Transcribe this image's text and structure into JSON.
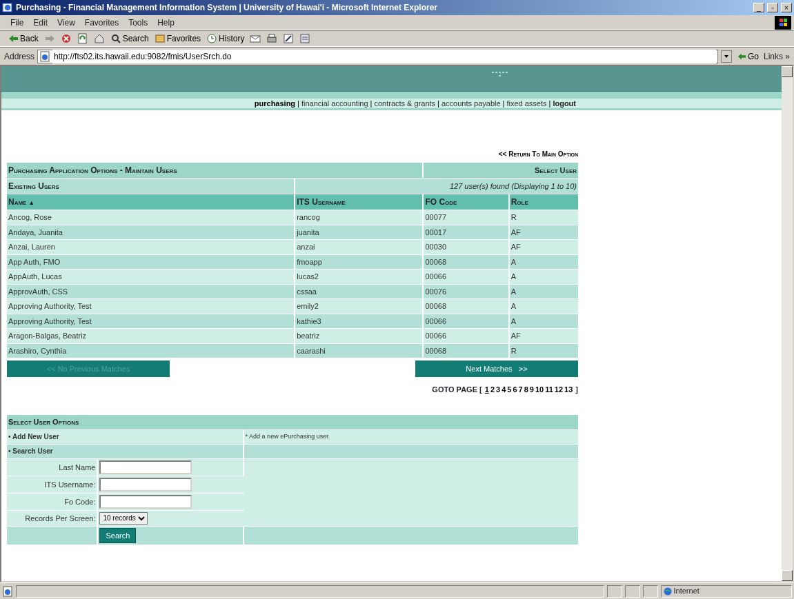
{
  "window": {
    "title": "Purchasing - Financial Management Information System | University of Hawai'i - Microsoft Internet Explorer",
    "controls": [
      "_",
      "▫",
      "×"
    ]
  },
  "menu": [
    "File",
    "Edit",
    "View",
    "Favorites",
    "Tools",
    "Help"
  ],
  "toolbar": [
    {
      "kind": "back",
      "label": "Back"
    },
    {
      "kind": "forward"
    },
    {
      "kind": "stop"
    },
    {
      "kind": "refresh"
    },
    {
      "kind": "home"
    },
    {
      "kind": "search",
      "label": "Search"
    },
    {
      "kind": "favorites",
      "label": "Favorites"
    },
    {
      "kind": "history",
      "label": "History"
    },
    {
      "kind": "mail"
    },
    {
      "kind": "print"
    },
    {
      "kind": "edit"
    },
    {
      "kind": "discuss"
    }
  ],
  "address": {
    "label": "Address",
    "value": "http://fts02.its.hawaii.edu:9082/fmis/UserSrch.do",
    "go": "Go",
    "links": "Links »"
  },
  "nav_separator": "|",
  "nav": [
    {
      "label": "purchasing",
      "selected": true,
      "kind": "module"
    },
    {
      "label": "financial accounting",
      "selected": false,
      "kind": "module"
    },
    {
      "label": "contracts & grants",
      "selected": false,
      "kind": "module"
    },
    {
      "label": "accounts payable",
      "selected": false,
      "kind": "module"
    },
    {
      "label": "fixed assets",
      "selected": false,
      "kind": "module"
    },
    {
      "label": "logout",
      "selected": false,
      "kind": "action"
    }
  ],
  "return_link": "<< Return To Main Option",
  "panel": {
    "title": "Purchasing Application Options - Maintain Users",
    "action": "Select User",
    "subtitle": "Existing Users",
    "found": "127 user(s) found (Displaying 1 to 10)"
  },
  "table": {
    "columns": [
      {
        "label": "Name",
        "sort": "▲"
      },
      {
        "label": "ITS Username"
      },
      {
        "label": "FO Code"
      },
      {
        "label": "Role"
      }
    ],
    "rows": [
      [
        "Ancog, Rose",
        "rancog",
        "00077",
        "R"
      ],
      [
        "Andaya, Juanita",
        "juanita",
        "00017",
        "AF"
      ],
      [
        "Anzai, Lauren",
        "anzai",
        "00030",
        "AF"
      ],
      [
        "App Auth, FMO",
        "fmoapp",
        "00068",
        "A"
      ],
      [
        "AppAuth, Lucas",
        "lucas2",
        "00066",
        "A"
      ],
      [
        "ApprovAuth, CSS",
        "cssaa",
        "00076",
        "A"
      ],
      [
        "Approving Authority, Test",
        "emily2",
        "00068",
        "A"
      ],
      [
        "Approving Authority, Test",
        "kathie3",
        "00066",
        "A"
      ],
      [
        "Aragon-Balgas, Beatriz",
        "beatriz",
        "00066",
        "AF"
      ],
      [
        "Arashiro, Cynthia",
        "caarashi",
        "00068",
        "R"
      ]
    ]
  },
  "pager": {
    "previous": {
      "label": "<< No Previous Matches",
      "disabled": true
    },
    "next": {
      "label": "Next Matches   >>",
      "disabled": false
    },
    "goto_label": "GOTO PAGE [",
    "pages": [
      {
        "label": "1",
        "selected": true
      },
      {
        "label": "2",
        "selected": false
      },
      {
        "label": "3",
        "selected": false
      },
      {
        "label": "4",
        "selected": false
      },
      {
        "label": "5",
        "selected": false
      },
      {
        "label": "6",
        "selected": false
      },
      {
        "label": "7",
        "selected": false
      },
      {
        "label": "8",
        "selected": false
      },
      {
        "label": "9",
        "selected": false
      },
      {
        "label": "10",
        "selected": false
      },
      {
        "label": "11",
        "selected": false
      },
      {
        "label": "12",
        "selected": false
      },
      {
        "label": "13",
        "selected": false
      }
    ],
    "goto_end": "]"
  },
  "options": {
    "title": "Select User Options",
    "add_user": "• Add New User",
    "add_user_note": "* Add a new ePurchasing user.",
    "search_user": "• Search User",
    "fields": [
      {
        "label": "Last Name",
        "kind": "text"
      },
      {
        "label": "ITS Username:",
        "kind": "text"
      },
      {
        "label": "Fo Code:",
        "kind": "text"
      },
      {
        "label": "Records Per Screen:",
        "kind": "select",
        "value": "10 records"
      }
    ],
    "search_button": "Search"
  },
  "status_bar": {
    "zone": "Internet"
  }
}
